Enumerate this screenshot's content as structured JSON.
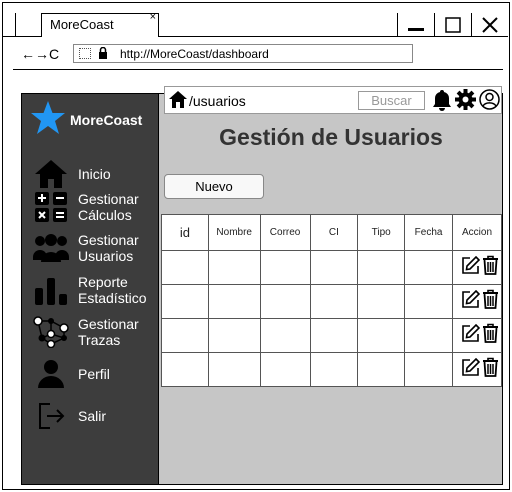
{
  "browser": {
    "tab_title": "MoreCoast",
    "tab_close": "×",
    "url": "http://MoreCoast/dashboard",
    "nav_glyphs": "←→C"
  },
  "sidebar": {
    "brand": "MoreCoast",
    "items": [
      {
        "label": "Inicio",
        "icon": "home-icon"
      },
      {
        "label": "Gestionar Cálculos",
        "icon": "calculator-icon"
      },
      {
        "label": "Gestionar Usuarios",
        "icon": "users-icon"
      },
      {
        "label": "Reporte Estadístico",
        "icon": "bar-chart-icon"
      },
      {
        "label": "Gestionar Trazas",
        "icon": "network-icon"
      },
      {
        "label": "Perfil",
        "icon": "user-icon"
      },
      {
        "label": "Salir",
        "icon": "logout-icon"
      }
    ]
  },
  "topbar": {
    "breadcrumb": "/usuarios",
    "search_placeholder": "Buscar"
  },
  "page": {
    "title": "Gestión de Usuarios",
    "new_button": "Nuevo"
  },
  "table": {
    "columns": [
      "id",
      "Nombre",
      "Correo",
      "CI",
      "Tipo",
      "Fecha",
      "Accion"
    ],
    "row_count": 4
  },
  "colors": {
    "sidebar_bg": "#3d3d3d",
    "content_bg": "#c6c6c6",
    "star": "#2196f3"
  }
}
